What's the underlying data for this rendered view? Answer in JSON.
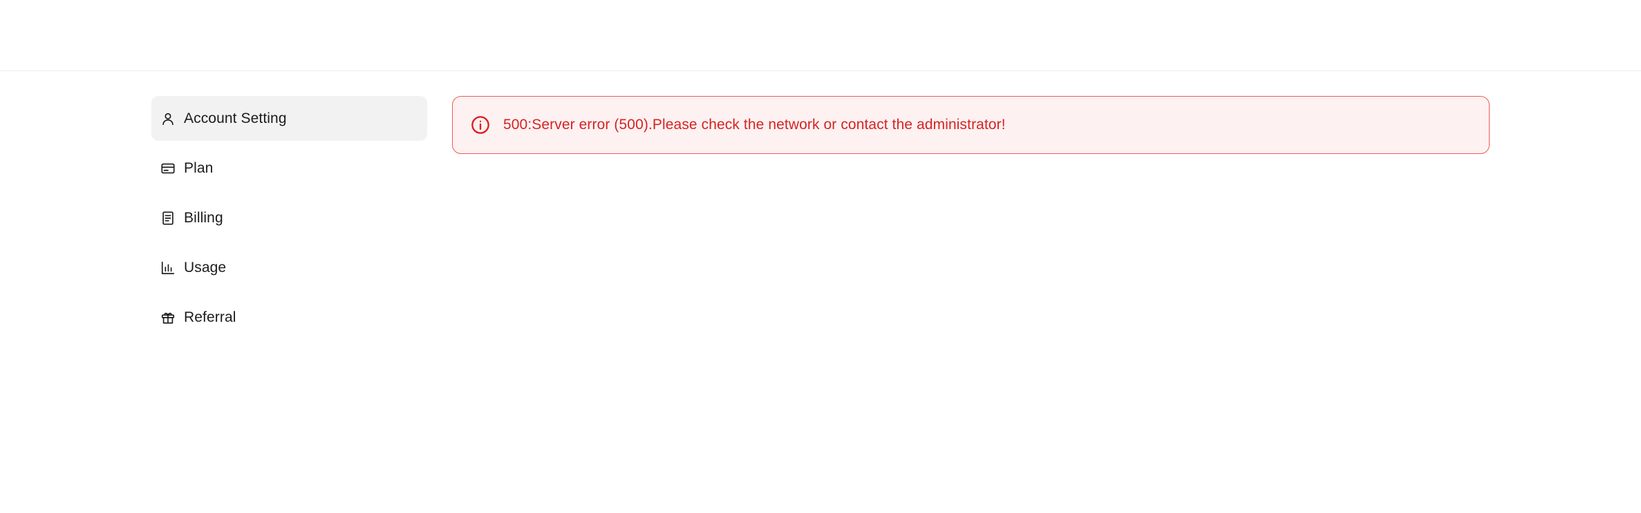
{
  "sidebar": {
    "items": [
      {
        "label": "Account Setting",
        "icon": "user-icon",
        "active": true
      },
      {
        "label": "Plan",
        "icon": "credit-card-icon",
        "active": false
      },
      {
        "label": "Billing",
        "icon": "receipt-icon",
        "active": false
      },
      {
        "label": "Usage",
        "icon": "bar-chart-icon",
        "active": false
      },
      {
        "label": "Referral",
        "icon": "gift-icon",
        "active": false
      }
    ]
  },
  "alert": {
    "type": "error",
    "icon": "info-circle-icon",
    "message": "500:Server error (500).Please check the network or contact the administrator!"
  },
  "colors": {
    "error_text": "#d42424",
    "error_border": "#ef5a5a",
    "error_background": "#fdf1f1",
    "active_nav_background": "#f2f2f2"
  }
}
